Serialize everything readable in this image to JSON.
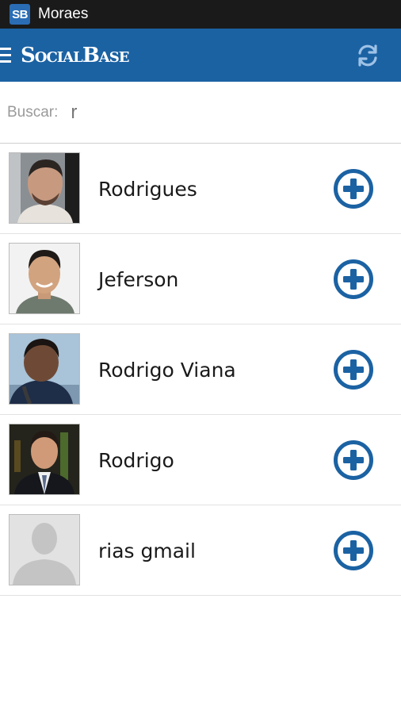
{
  "statusbar": {
    "app_icon_text": "SB",
    "title": "Moraes"
  },
  "appbar": {
    "brand": "SocialBase",
    "refresh_icon": "refresh-icon",
    "menu_icon": "menu-icon"
  },
  "search": {
    "label": "Buscar:",
    "value": "r"
  },
  "results": [
    {
      "name": "Rodrigues",
      "avatar": "photo"
    },
    {
      "name": "Jeferson",
      "avatar": "photo"
    },
    {
      "name": "Rodrigo Viana",
      "avatar": "photo"
    },
    {
      "name": "Rodrigo",
      "avatar": "photo"
    },
    {
      "name": "rias gmail",
      "avatar": "placeholder-silhouette"
    }
  ],
  "colors": {
    "appbar": "#1b62a3",
    "statusbar": "#1a1a1a",
    "add_button": "#1b62a3"
  }
}
